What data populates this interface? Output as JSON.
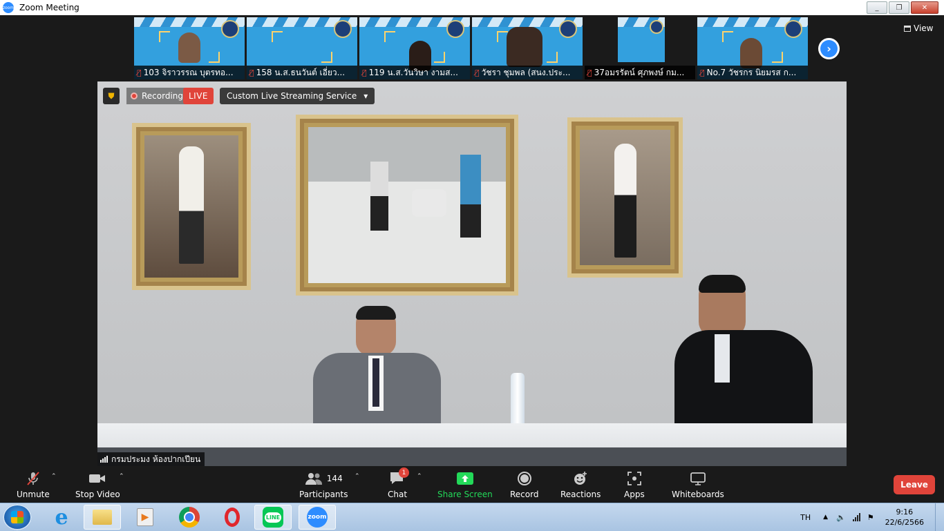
{
  "window": {
    "title": "Zoom Meeting",
    "buttons": [
      "_",
      "❐",
      "✕"
    ]
  },
  "thumbnails": [
    {
      "name": "103 จิราวรรณ บุตรทอ..."
    },
    {
      "name": "158 น.ส.ธนวันต์ เอี่ยว..."
    },
    {
      "name": "119 น.ส.วันวิษา งามส..."
    },
    {
      "name": "วัชรา  ชุมพล (สนง.ประ..."
    },
    {
      "name": "37อมรรัตน์ ศุภพงษ์ กม..."
    },
    {
      "name": "No.7 วัชรกร นิยมรส ก..."
    }
  ],
  "view_label": "View",
  "stage": {
    "recording_label": "Recording",
    "live_label": "LIVE",
    "stream_label": "Custom Live Streaming Service",
    "speaker_name": "กรมประมง ห้องปากเปียน"
  },
  "toolbar": {
    "unmute": "Unmute",
    "stop_video": "Stop Video",
    "participants": "Participants",
    "participants_count": "144",
    "chat": "Chat",
    "chat_badge": "1",
    "share_screen": "Share Screen",
    "record": "Record",
    "reactions": "Reactions",
    "apps": "Apps",
    "whiteboards": "Whiteboards",
    "leave": "Leave"
  },
  "taskbar": {
    "apps": [
      "ie",
      "explorer",
      "media-player",
      "chrome",
      "opera",
      "line",
      "zoom"
    ],
    "line_label": "LINE",
    "zoom_label": "zoom",
    "lang": "TH",
    "time": "9:16",
    "date": "22/6/2566"
  },
  "colors": {
    "accent": "#2d8cff",
    "danger": "#e0443a",
    "share": "#23d959",
    "toolbar": "#1a1a1a"
  }
}
